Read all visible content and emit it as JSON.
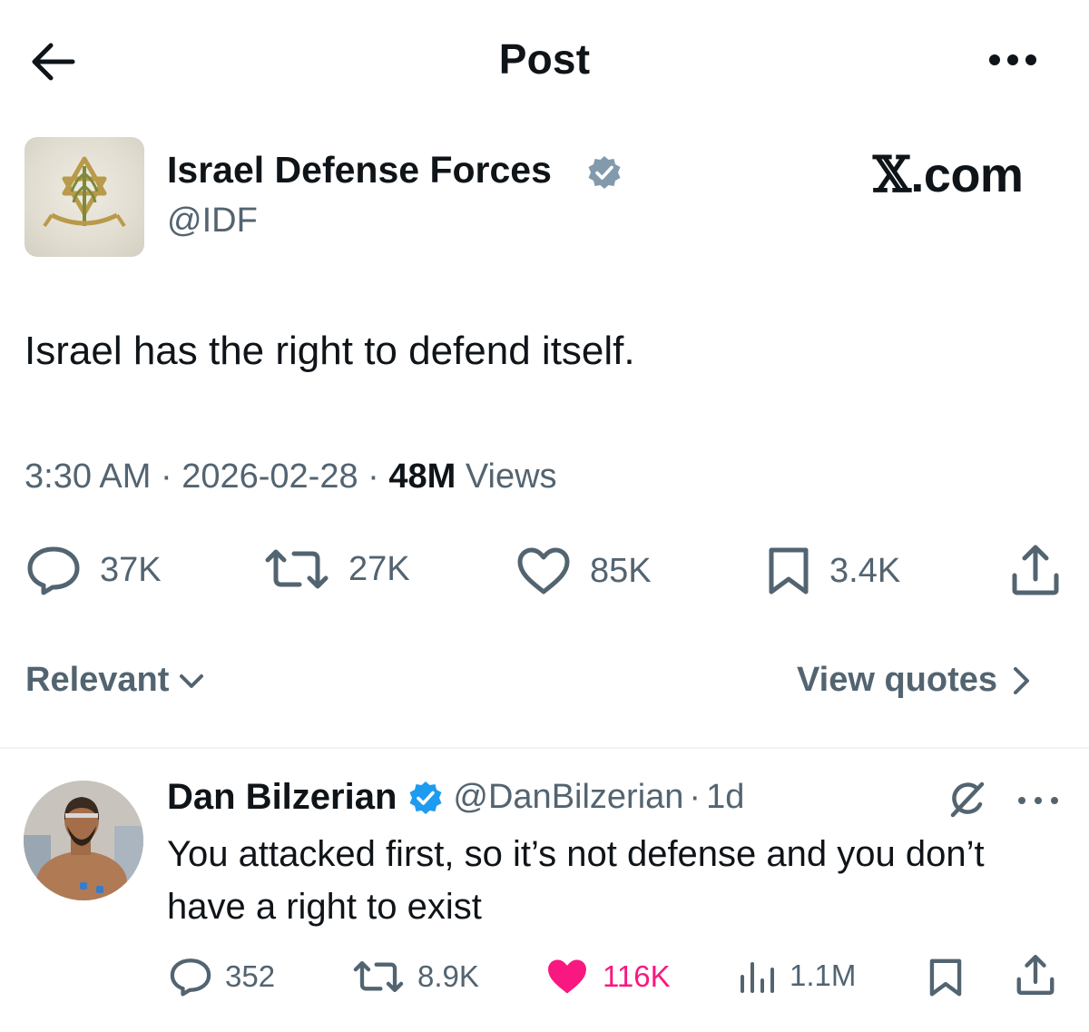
{
  "header": {
    "title": "Post",
    "back_icon": "arrow-left-icon",
    "more_icon": "more-horizontal-icon"
  },
  "post": {
    "author_name": "Israel Defense Forces",
    "author_handle": "@IDF",
    "verified": true,
    "avatar_icon": "idf-emblem-icon",
    "watermark": {
      "x": "𝕏",
      "rest": ".com"
    },
    "text": "Israel has the right to defend itself.",
    "time": "3:30 AM",
    "date": "2026-02-28",
    "views_count": "48M",
    "views_label": "Views",
    "separator": "·",
    "actions": {
      "replies": "37K",
      "reposts": "27K",
      "likes": "85K",
      "bookmarks": "3.4K"
    }
  },
  "replies_bar": {
    "sort_label": "Relevant",
    "view_quotes_label": "View quotes"
  },
  "reply": {
    "author_name": "Dan Bilzerian",
    "author_handle": "@DanBilzerian",
    "separator": "·",
    "age": "1d",
    "verified": true,
    "text": "You attacked first, so it’s not defense and you don’t have a right to exist",
    "actions": {
      "replies": "352",
      "reposts": "8.9K",
      "likes": "116K",
      "views": "1.1M"
    }
  },
  "colors": {
    "text": "#0f1419",
    "secondary": "#536471",
    "verified": "#1d9bf0",
    "verified_gray": "#829aab",
    "like": "#f91880",
    "divider": "#eff3f4"
  }
}
